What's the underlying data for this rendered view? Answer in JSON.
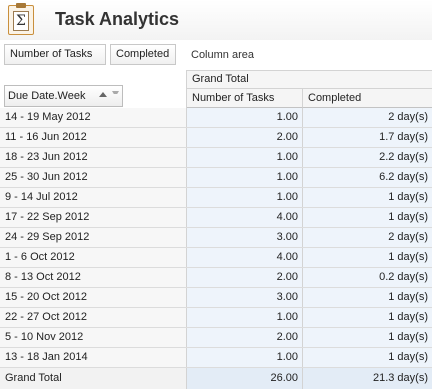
{
  "app": {
    "title": "Task Analytics"
  },
  "filter_area": {
    "data_fields": [
      "Number of Tasks",
      "Completed"
    ],
    "column_area_label": "Column area"
  },
  "row_field": {
    "label": "Due Date.Week"
  },
  "columns": {
    "grand_total": "Grand Total",
    "measures": [
      "Number of Tasks",
      "Completed"
    ]
  },
  "rows": [
    {
      "week": "14 - 19 May 2012",
      "tasks": "1.00",
      "completed": "2 day(s)"
    },
    {
      "week": "11 - 16 Jun 2012",
      "tasks": "2.00",
      "completed": "1.7 day(s)"
    },
    {
      "week": "18 - 23 Jun 2012",
      "tasks": "1.00",
      "completed": "2.2 day(s)"
    },
    {
      "week": "25 - 30 Jun 2012",
      "tasks": "1.00",
      "completed": "6.2 day(s)"
    },
    {
      "week": "9 - 14 Jul 2012",
      "tasks": "1.00",
      "completed": "1 day(s)"
    },
    {
      "week": "17 - 22 Sep 2012",
      "tasks": "4.00",
      "completed": "1 day(s)"
    },
    {
      "week": "24 - 29 Sep 2012",
      "tasks": "3.00",
      "completed": "2 day(s)"
    },
    {
      "week": "1 - 6 Oct 2012",
      "tasks": "4.00",
      "completed": "1 day(s)"
    },
    {
      "week": "8 - 13 Oct 2012",
      "tasks": "2.00",
      "completed": "0.2 day(s)"
    },
    {
      "week": "15 - 20 Oct 2012",
      "tasks": "3.00",
      "completed": "1 day(s)"
    },
    {
      "week": "22 - 27 Oct 2012",
      "tasks": "1.00",
      "completed": "1 day(s)"
    },
    {
      "week": "5 - 10 Nov 2012",
      "tasks": "2.00",
      "completed": "1 day(s)"
    },
    {
      "week": "13 - 18 Jan 2014",
      "tasks": "1.00",
      "completed": "1 day(s)"
    }
  ],
  "grand_total": {
    "label": "Grand Total",
    "tasks": "26.00",
    "completed": "21.3 day(s)"
  }
}
